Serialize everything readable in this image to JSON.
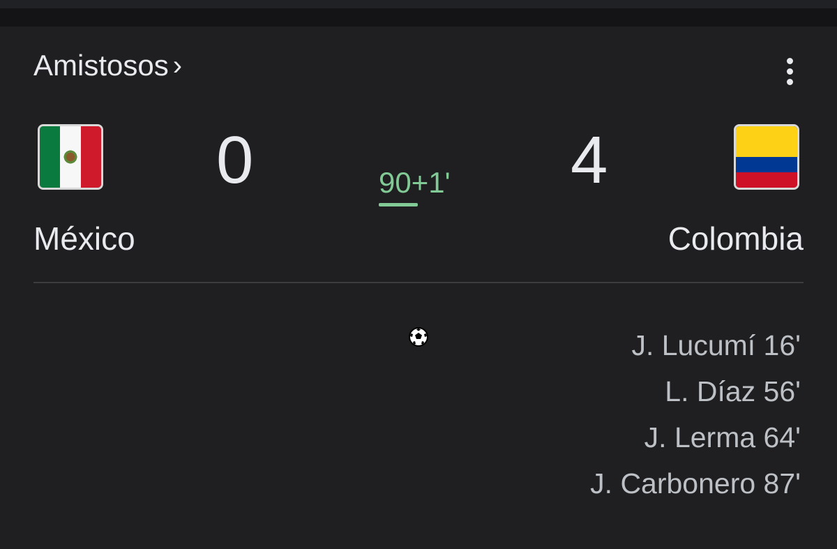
{
  "header": {
    "league": "Amistosos",
    "league_chevron": "›"
  },
  "match": {
    "home": {
      "name": "México",
      "score": "0",
      "flag_icon": "mexico-flag-icon"
    },
    "away": {
      "name": "Colombia",
      "score": "4",
      "flag_icon": "colombia-flag-icon"
    },
    "clock": "90+1'"
  },
  "events": {
    "goal_icon": "soccer-ball-icon",
    "away_scorers": [
      "J. Lucumí 16'",
      "L. Díaz 56'",
      "J. Lerma 64'",
      "J. Carbonero 87'"
    ]
  },
  "colors": {
    "background": "#1f1f21",
    "text": "#e8eaed",
    "secondary_text": "#bdc1c6",
    "live_green": "#81c995"
  }
}
